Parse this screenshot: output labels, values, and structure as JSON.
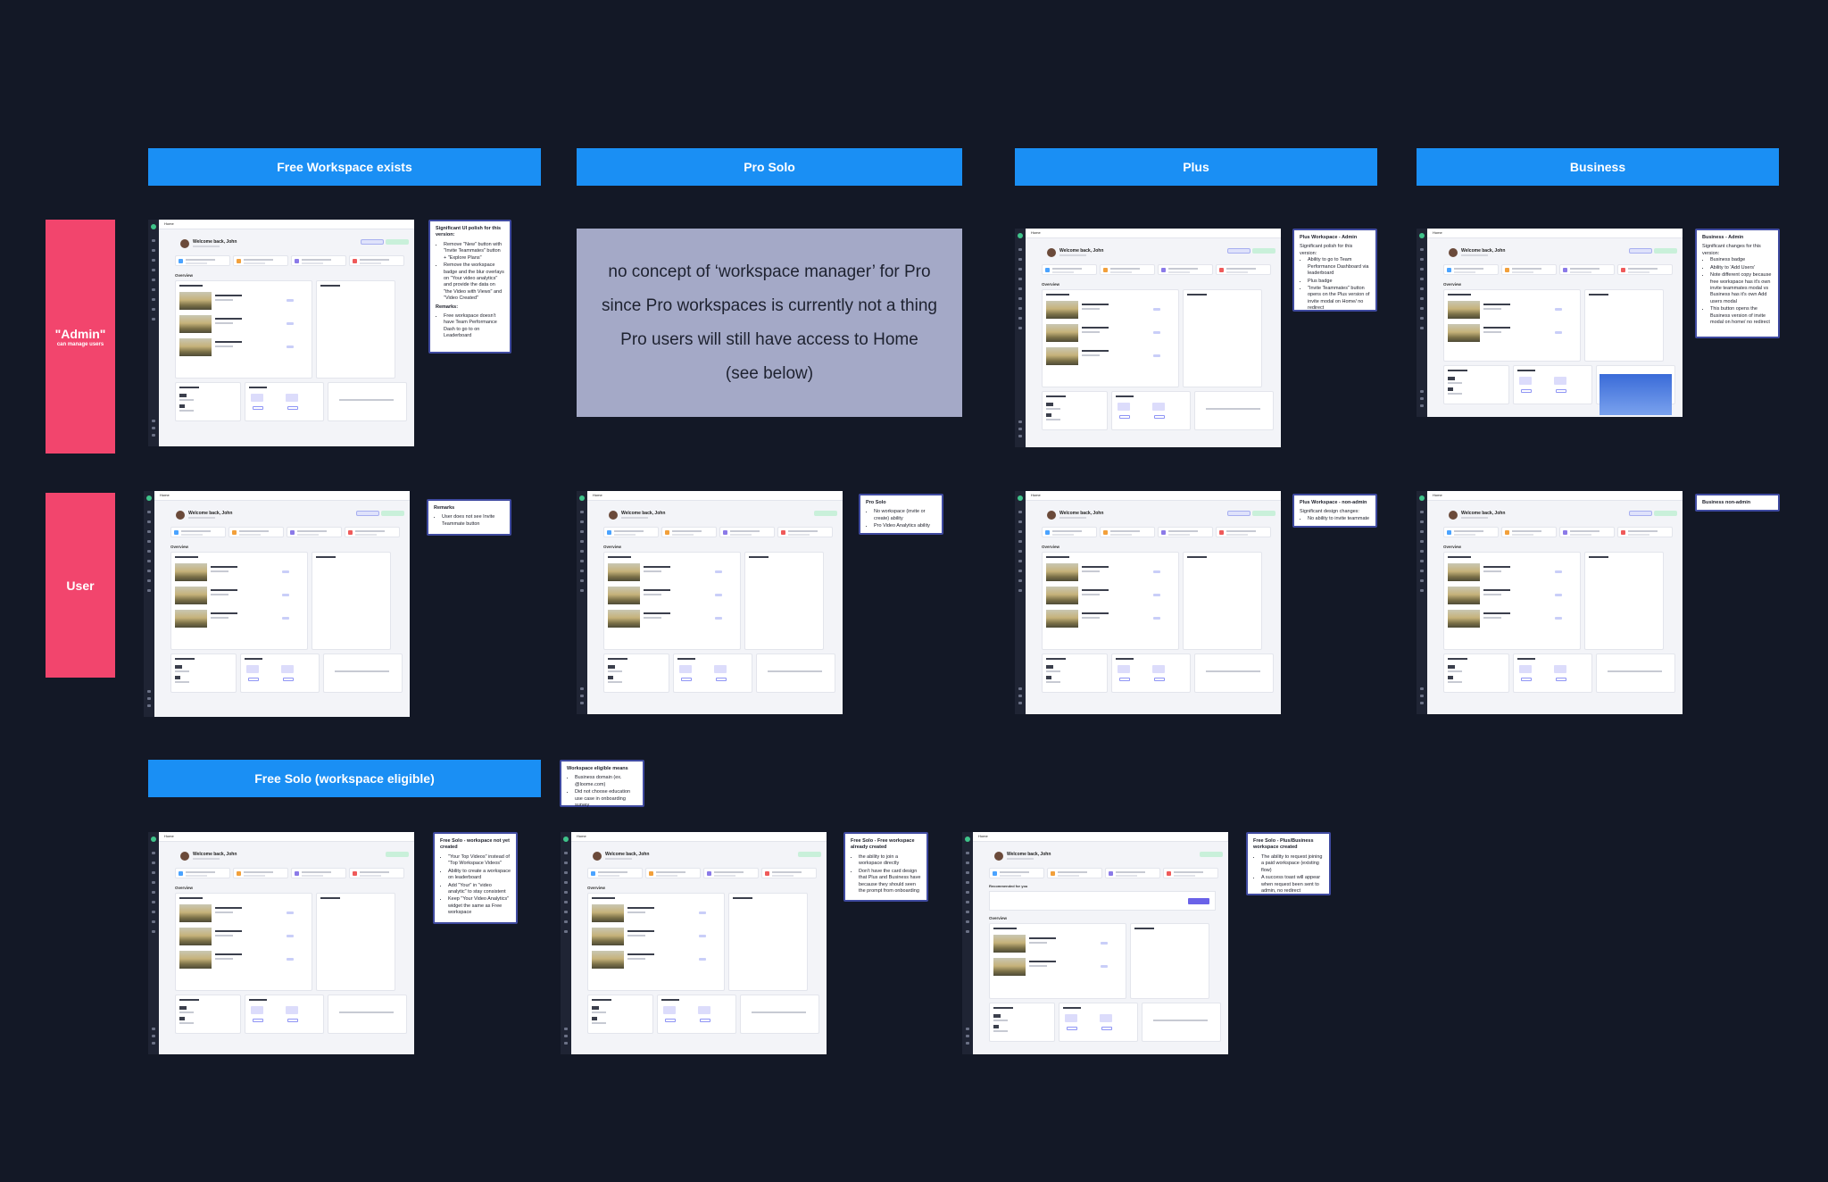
{
  "columns": {
    "free_workspace": "Free Workspace exists",
    "pro_solo": "Pro Solo",
    "plus": "Plus",
    "business": "Business",
    "free_solo": "Free Solo (workspace eligible)"
  },
  "rows": {
    "admin": {
      "label": "\"Admin\"",
      "sub": "can manage users"
    },
    "user": {
      "label": "User"
    }
  },
  "pro_placeholder": {
    "line1": "no concept of ‘workspace manager’ for Pro",
    "line2": "since Pro workspaces is currently not a thing",
    "line3": "Pro users will still have access to Home",
    "line4": "(see below)"
  },
  "notes": {
    "free_admin": {
      "title": "Significant UI polish for this version:",
      "items": [
        "Remove \"New\" button with \"Invite Teammates\" button + \"Explore Plans\"",
        "Remove the workspace badge and the blur overlays on \"Your video analytics\" and provide the data on \"the Video with Views\" and \"Video Created\""
      ],
      "remarks_title": "Remarks:",
      "remarks": [
        "Free workspace doesn't have Team Performance Dash to go to on Leaderboard"
      ]
    },
    "plus_admin": {
      "title": "Plus Workspace - Admin",
      "subtitle": "Significant polish for this version:",
      "items": [
        "Ability to go to Team Performance Dashboard via leaderboard",
        "Plus badge",
        "\"Invite Teammates\" button opens on the Plus version of invite modal on Home/ no redirect"
      ]
    },
    "business_admin": {
      "title": "Business - Admin",
      "subtitle": "Significant changes for this version:",
      "items": [
        "Business badge",
        "Ability to 'Add Users'",
        "Note different copy because free workspace has it's own invite teammates modal vs Business has it's own Add users modal",
        "This button opens the Business version of invite modal on home/ no redirect"
      ]
    },
    "free_user": {
      "title": "Remarks",
      "items": [
        "User does not see Invite Teammate button"
      ]
    },
    "pro_user": {
      "title": "Pro Solo",
      "items": [
        "No workspace (invite or create) ability",
        "Pro Video Analytics ability"
      ]
    },
    "plus_user": {
      "title": "Plus Workspace - non-admin",
      "subtitle": "Significant design changes:",
      "items": [
        "No ability to invite teammate"
      ]
    },
    "business_user": {
      "title": "Business non-admin"
    },
    "eligible": {
      "title": "Workspace eligible means",
      "items": [
        "Business domain (ex. @loome.com)",
        "Did not choose education use case in onboarding survey"
      ]
    },
    "fs_not_created": {
      "title": "Free Solo - workspace not yet created",
      "items": [
        "\"Your Top Videos\" instead of \"Top Workspace Videos\"",
        "Ability to create a workspace on leaderboard",
        "Add \"Your\" in \"video analytic\" to stay consistent",
        "Keep \"Your Video Analytics\" widget the same as Free workspace"
      ]
    },
    "fs_exists": {
      "title": "Free Solo - Free workspace already created",
      "items": [
        "the ability to join a workspace directly",
        "Don't have the card design that Plus and Business have because they should seen the prompt from onboarding"
      ]
    },
    "fs_plusbiz": {
      "title": "Free Solo - Plus/Business workspace created",
      "items": [
        "The ability to request joining a paid workspace (existing flow)",
        "A success toast will appear when request been sent to admin, no redirect"
      ]
    }
  },
  "mock": {
    "home": "Home",
    "welcome": "Welcome back, John",
    "overview": "Overview",
    "recommended": "Recommended for you"
  },
  "colors": {
    "background": "#131826",
    "column_header": "#1a8ff4",
    "row_label": "#f2456d",
    "pro_box": "#a4a9c7",
    "note_border": "#3f4aa0"
  }
}
